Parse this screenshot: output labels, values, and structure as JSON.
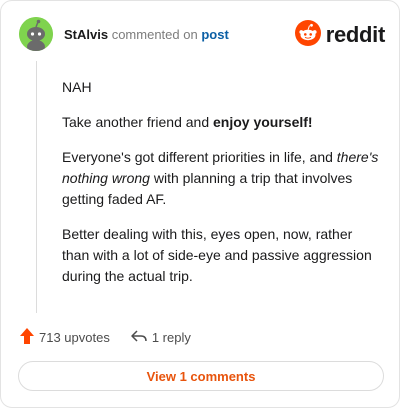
{
  "comment": {
    "username": "StAlvis",
    "verb": "commented on",
    "post_link": "post",
    "paragraphs": [
      [
        "NAH"
      ],
      [
        "Take another friend and ",
        "enjoy yourself!"
      ],
      [
        "Everyone's got different priorities in life, and ",
        "there's nothing wrong",
        " with planning a trip that involves getting faded AF."
      ],
      [
        "Better dealing with this, eyes open, now, rather than with a lot of side-eye and passive aggression during the actual trip."
      ]
    ]
  },
  "brand": {
    "wordmark": "reddit",
    "color": "#ff4500"
  },
  "actions": {
    "upvotes": "713 upvotes",
    "replies": "1 reply"
  },
  "footer": {
    "view_comments": "View 1 comments"
  },
  "icons": {
    "avatar": "snoo-avatar-icon",
    "logo": "reddit-snoo-icon",
    "upvote": "upvote-arrow-icon",
    "reply": "reply-arrow-icon"
  },
  "colors": {
    "accent": "#e8540d",
    "upvote": "#ff4500",
    "link": "#0b5fa5",
    "avatar_bg": "#7fd34e"
  }
}
